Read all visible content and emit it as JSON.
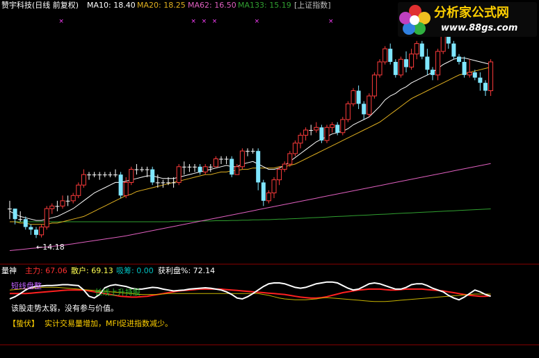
{
  "header": {
    "stock": "赞宇科技(日线 前复权)",
    "ma10": "MA10: 18.40",
    "ma20": "MA20: 18.25",
    "ma62": "MA62: 16.50",
    "ma133": "MA133: 15.19",
    "index": "[上证指数]"
  },
  "logo": {
    "title": "分析家公式网",
    "url": "www.88gs.com"
  },
  "main_annotations": {
    "low_label": "←14.18"
  },
  "indicator": {
    "name": "量神",
    "zhuli": "主力: 67.06",
    "sanhu": "散户: 69.13",
    "xichou": "吸筹: 0.00",
    "huoli": "获利盘%: 72.14",
    "label_short": "短线盘整",
    "label_long": "长线上升持股",
    "advice1": "该股走势太弱，没有参与价值。",
    "advice2_tag": "【蛰伏】",
    "advice2": "实计交易量增加，MFI促进指数减少。"
  },
  "colors": {
    "bg": "#000000",
    "up": "#ff3b3b",
    "down": "#7fe6ff",
    "flat": "#ffffff",
    "ma10": "#ffffff",
    "ma20": "#e0b020",
    "ma62": "#e060c0",
    "ma133": "#30a030",
    "zhuli": "#ff3030",
    "sanhu": "#ffff50",
    "xichou": "#00c0c0",
    "ind_white": "#ffffff",
    "ind_red": "#ff2020",
    "ind_yellow": "#c8b400",
    "border": "#8b0000",
    "marker": "#ff40ff"
  },
  "chart_data": [
    {
      "type": "candlestick",
      "title": "赞宇科技(日线 前复权)",
      "ylim": [
        13.5,
        22.2
      ],
      "candles": [
        [
          15.3,
          15.3,
          15.6,
          14.9
        ],
        [
          15.3,
          14.9,
          15.3,
          14.7
        ],
        [
          14.9,
          14.9,
          15.2,
          14.8
        ],
        [
          14.9,
          14.6,
          15.0,
          14.5
        ],
        [
          14.6,
          14.5,
          14.7,
          14.3
        ],
        [
          14.5,
          14.3,
          14.6,
          14.18
        ],
        [
          14.3,
          14.6,
          14.7,
          14.2
        ],
        [
          14.6,
          15.3,
          15.4,
          14.5
        ],
        [
          15.3,
          15.4,
          15.5,
          15.1
        ],
        [
          15.4,
          15.4,
          15.6,
          15.2
        ],
        [
          15.4,
          15.6,
          15.8,
          15.3
        ],
        [
          15.6,
          15.6,
          15.8,
          15.4
        ],
        [
          15.6,
          15.8,
          15.9,
          15.5
        ],
        [
          15.8,
          16.2,
          16.3,
          15.7
        ],
        [
          16.2,
          16.6,
          16.8,
          16.1
        ],
        [
          16.6,
          16.6,
          16.7,
          16.4
        ],
        [
          16.6,
          16.6,
          16.7,
          16.5
        ],
        [
          16.6,
          16.6,
          16.7,
          16.4
        ],
        [
          16.6,
          16.6,
          16.7,
          16.5
        ],
        [
          16.6,
          16.6,
          16.7,
          16.5
        ],
        [
          16.6,
          16.6,
          16.8,
          16.5
        ],
        [
          16.6,
          15.8,
          16.7,
          15.7
        ],
        [
          15.8,
          16.3,
          16.5,
          15.7
        ],
        [
          16.3,
          16.8,
          16.9,
          16.2
        ],
        [
          16.8,
          16.8,
          17.0,
          16.6
        ],
        [
          16.8,
          16.8,
          16.9,
          16.7
        ],
        [
          16.8,
          16.8,
          16.9,
          16.5
        ],
        [
          16.8,
          16.3,
          16.9,
          16.2
        ],
        [
          16.3,
          16.3,
          16.6,
          16.1
        ],
        [
          16.3,
          16.3,
          16.4,
          16.1
        ],
        [
          16.3,
          16.3,
          16.5,
          16.2
        ],
        [
          16.3,
          16.3,
          16.5,
          16.1
        ],
        [
          16.3,
          16.9,
          17.0,
          16.2
        ],
        [
          16.9,
          16.9,
          17.1,
          16.6
        ],
        [
          16.9,
          16.9,
          17.0,
          16.7
        ],
        [
          16.9,
          16.9,
          17.0,
          16.7
        ],
        [
          16.9,
          16.7,
          17.0,
          16.6
        ],
        [
          16.7,
          16.9,
          17.0,
          16.6
        ],
        [
          16.9,
          16.9,
          17.0,
          16.7
        ],
        [
          16.9,
          17.2,
          17.3,
          16.9
        ],
        [
          17.2,
          17.2,
          17.3,
          17.0
        ],
        [
          17.2,
          17.2,
          17.3,
          17.0
        ],
        [
          17.2,
          16.6,
          17.3,
          16.5
        ],
        [
          16.6,
          16.9,
          17.0,
          16.6
        ],
        [
          16.9,
          17.5,
          17.6,
          16.8
        ],
        [
          17.5,
          17.5,
          17.6,
          17.3
        ],
        [
          17.5,
          17.5,
          17.6,
          17.4
        ],
        [
          17.5,
          16.3,
          17.6,
          16.0
        ],
        [
          16.3,
          15.6,
          16.4,
          15.4
        ],
        [
          15.6,
          15.9,
          16.0,
          15.5
        ],
        [
          15.9,
          16.4,
          16.5,
          15.7
        ],
        [
          16.4,
          16.8,
          16.9,
          16.2
        ],
        [
          16.8,
          17.0,
          17.1,
          16.7
        ],
        [
          17.0,
          17.4,
          17.5,
          16.9
        ],
        [
          17.4,
          17.8,
          17.9,
          17.3
        ],
        [
          17.8,
          18.1,
          18.2,
          17.6
        ],
        [
          18.1,
          18.3,
          18.4,
          17.9
        ],
        [
          18.3,
          18.3,
          18.5,
          18.1
        ],
        [
          18.3,
          18.4,
          18.6,
          18.2
        ],
        [
          18.4,
          17.9,
          18.5,
          17.8
        ],
        [
          17.9,
          18.4,
          18.5,
          17.8
        ],
        [
          18.4,
          18.5,
          18.6,
          18.2
        ],
        [
          18.5,
          18.2,
          18.6,
          18.1
        ],
        [
          18.2,
          18.7,
          18.8,
          18.1
        ],
        [
          18.7,
          19.3,
          19.4,
          18.6
        ],
        [
          19.3,
          19.8,
          19.9,
          19.2
        ],
        [
          19.8,
          19.3,
          20.0,
          19.1
        ],
        [
          19.3,
          18.9,
          19.4,
          18.7
        ],
        [
          18.9,
          19.6,
          19.7,
          18.8
        ],
        [
          19.6,
          20.4,
          20.5,
          19.5
        ],
        [
          20.4,
          20.9,
          21.0,
          20.3
        ],
        [
          20.9,
          21.4,
          21.5,
          20.8
        ],
        [
          21.4,
          20.9,
          21.6,
          20.8
        ],
        [
          20.9,
          20.4,
          21.0,
          20.3
        ],
        [
          20.4,
          21.0,
          21.1,
          20.3
        ],
        [
          21.0,
          20.7,
          21.3,
          20.5
        ],
        [
          20.7,
          21.2,
          21.4,
          20.6
        ],
        [
          21.2,
          21.6,
          21.7,
          21.0
        ],
        [
          21.6,
          21.1,
          21.7,
          21.0
        ],
        [
          21.1,
          20.6,
          21.4,
          20.4
        ],
        [
          20.6,
          20.4,
          20.7,
          20.2
        ],
        [
          20.4,
          21.3,
          21.4,
          20.2
        ],
        [
          21.3,
          21.9,
          22.0,
          21.2
        ],
        [
          21.9,
          21.6,
          22.1,
          21.4
        ],
        [
          21.6,
          21.1,
          21.7,
          21.0
        ],
        [
          21.1,
          20.9,
          21.2,
          20.8
        ],
        [
          20.9,
          20.4,
          21.1,
          20.3
        ],
        [
          20.4,
          20.5,
          21.0,
          20.3
        ],
        [
          20.5,
          20.3,
          20.6,
          20.2
        ],
        [
          20.3,
          20.1,
          20.5,
          19.8
        ],
        [
          20.1,
          19.8,
          20.2,
          19.6
        ],
        [
          19.8,
          20.9,
          21.0,
          19.6
        ]
      ],
      "ma10": [
        15.2,
        15.1,
        15.0,
        14.95,
        14.9,
        14.85,
        14.85,
        14.9,
        14.95,
        15.0,
        15.1,
        15.2,
        15.3,
        15.45,
        15.6,
        15.75,
        15.9,
        16.0,
        16.1,
        16.2,
        16.3,
        16.3,
        16.35,
        16.4,
        16.45,
        16.5,
        16.55,
        16.55,
        16.5,
        16.45,
        16.45,
        16.45,
        16.5,
        16.55,
        16.6,
        16.65,
        16.7,
        16.75,
        16.8,
        16.85,
        16.9,
        16.95,
        16.9,
        16.9,
        17.0,
        17.05,
        17.1,
        17.0,
        16.9,
        16.8,
        16.8,
        16.85,
        16.95,
        17.1,
        17.25,
        17.4,
        17.55,
        17.7,
        17.85,
        17.95,
        18.05,
        18.15,
        18.2,
        18.25,
        18.35,
        18.5,
        18.6,
        18.7,
        18.8,
        19.0,
        19.2,
        19.45,
        19.6,
        19.7,
        19.85,
        19.95,
        20.1,
        20.2,
        20.3,
        20.4,
        20.5,
        20.65,
        20.8,
        20.9,
        21.0,
        21.05,
        21.05,
        21.0,
        20.95,
        20.9,
        20.85,
        20.8
      ],
      "ma20": [
        14.8,
        14.8,
        14.75,
        14.75,
        14.7,
        14.7,
        14.7,
        14.7,
        14.75,
        14.75,
        14.8,
        14.85,
        14.9,
        14.95,
        15.0,
        15.1,
        15.2,
        15.3,
        15.4,
        15.5,
        15.6,
        15.7,
        15.8,
        15.85,
        15.95,
        16.0,
        16.05,
        16.1,
        16.15,
        16.2,
        16.25,
        16.3,
        16.35,
        16.4,
        16.45,
        16.5,
        16.55,
        16.6,
        16.6,
        16.65,
        16.7,
        16.7,
        16.75,
        16.75,
        16.8,
        16.8,
        16.85,
        16.85,
        16.85,
        16.85,
        16.85,
        16.9,
        16.9,
        16.95,
        17.0,
        17.1,
        17.2,
        17.3,
        17.4,
        17.5,
        17.6,
        17.7,
        17.8,
        17.9,
        18.0,
        18.1,
        18.2,
        18.3,
        18.4,
        18.5,
        18.6,
        18.75,
        18.9,
        19.05,
        19.2,
        19.35,
        19.5,
        19.6,
        19.7,
        19.8,
        19.9,
        20.0,
        20.1,
        20.2,
        20.3,
        20.4,
        20.45,
        20.5,
        20.55,
        20.6,
        20.65,
        20.7
      ],
      "ma62": [
        13.7,
        13.72,
        13.74,
        13.76,
        13.78,
        13.8,
        13.82,
        13.84,
        13.86,
        13.88,
        13.9,
        13.93,
        13.96,
        13.99,
        14.02,
        14.05,
        14.08,
        14.11,
        14.14,
        14.17,
        14.2,
        14.23,
        14.26,
        14.3,
        14.34,
        14.38,
        14.42,
        14.46,
        14.5,
        14.54,
        14.58,
        14.62,
        14.66,
        14.7,
        14.74,
        14.78,
        14.82,
        14.86,
        14.9,
        14.94,
        14.98,
        15.02,
        15.06,
        15.1,
        15.14,
        15.18,
        15.22,
        15.26,
        15.3,
        15.34,
        15.38,
        15.42,
        15.46,
        15.5,
        15.54,
        15.58,
        15.62,
        15.66,
        15.7,
        15.74,
        15.78,
        15.82,
        15.86,
        15.9,
        15.94,
        15.98,
        16.02,
        16.06,
        16.1,
        16.14,
        16.18,
        16.22,
        16.26,
        16.3,
        16.34,
        16.38,
        16.42,
        16.46,
        16.5,
        16.54,
        16.58,
        16.62,
        16.66,
        16.7,
        16.74,
        16.78,
        16.82,
        16.86,
        16.9,
        16.94,
        16.98,
        17.02
      ],
      "ma133": [
        14.8,
        14.8,
        14.8,
        14.8,
        14.8,
        14.8,
        14.8,
        14.8,
        14.8,
        14.8,
        14.8,
        14.8,
        14.8,
        14.8,
        14.8,
        14.8,
        14.8,
        14.8,
        14.8,
        14.8,
        14.8,
        14.8,
        14.8,
        14.8,
        14.8,
        14.8,
        14.8,
        14.8,
        14.8,
        14.8,
        14.8,
        14.82,
        14.82,
        14.82,
        14.82,
        14.82,
        14.83,
        14.83,
        14.83,
        14.84,
        14.84,
        14.84,
        14.85,
        14.85,
        14.86,
        14.86,
        14.87,
        14.87,
        14.88,
        14.88,
        14.89,
        14.9,
        14.9,
        14.91,
        14.92,
        14.93,
        14.94,
        14.95,
        14.96,
        14.97,
        14.98,
        14.99,
        15.0,
        15.01,
        15.02,
        15.03,
        15.04,
        15.05,
        15.06,
        15.07,
        15.08,
        15.09,
        15.1,
        15.11,
        15.12,
        15.13,
        15.14,
        15.15,
        15.16,
        15.17,
        15.18,
        15.19,
        15.2,
        15.21,
        15.22,
        15.23,
        15.24,
        15.25,
        15.26,
        15.27,
        15.28,
        15.29
      ]
    },
    {
      "type": "line",
      "title": "量神",
      "ylim": [
        0,
        100
      ],
      "series": [
        {
          "name": "主力",
          "values": [
            62,
            62,
            62,
            62,
            63,
            64,
            65,
            66,
            67,
            68,
            69,
            70,
            70,
            70,
            70,
            68,
            66,
            64,
            62,
            60,
            58,
            56,
            55,
            54,
            54,
            55,
            56,
            58,
            60,
            62,
            64,
            66,
            68,
            69,
            70,
            71,
            72,
            72,
            72,
            72,
            72,
            71,
            70,
            69,
            68,
            67,
            66,
            65,
            64,
            63,
            62,
            61,
            60,
            58,
            56,
            54,
            53,
            52,
            52,
            53,
            55,
            58,
            61,
            64,
            66,
            68,
            70,
            71,
            72,
            72,
            72,
            71,
            70,
            70,
            71,
            72,
            72,
            72,
            72,
            71,
            70,
            69,
            68,
            66,
            64,
            62,
            60,
            58,
            57,
            56,
            56,
            57
          ]
        },
        {
          "name": "散户",
          "values": [
            70,
            71,
            72,
            73,
            74,
            75,
            76,
            76,
            76,
            76,
            75,
            74,
            73,
            72,
            71,
            70,
            69,
            68,
            67,
            66,
            65,
            64,
            63,
            62,
            61,
            60,
            60,
            60,
            60,
            61,
            62,
            62,
            62,
            62,
            62,
            62,
            62,
            62,
            62,
            62,
            62,
            62,
            62,
            62,
            62,
            62,
            62,
            62,
            60,
            58,
            55,
            52,
            50,
            49,
            48,
            48,
            48,
            49,
            50,
            52,
            53,
            52,
            51,
            50,
            49,
            48,
            47,
            46,
            45,
            44,
            44,
            44,
            45,
            46,
            47,
            48,
            49,
            50,
            51,
            52,
            53,
            54,
            55,
            56,
            57,
            58,
            59,
            60,
            61,
            61,
            61,
            61
          ]
        },
        {
          "name": "获利盘%",
          "values": [
            50,
            55,
            62,
            70,
            76,
            78,
            79,
            80,
            80,
            81,
            82,
            82,
            81,
            80,
            70,
            56,
            52,
            60,
            75,
            80,
            82,
            80,
            78,
            74,
            72,
            72,
            74,
            76,
            75,
            72,
            70,
            68,
            69,
            70,
            72,
            73,
            74,
            75,
            74,
            72,
            70,
            66,
            60,
            52,
            50,
            55,
            62,
            70,
            78,
            84,
            86,
            86,
            84,
            80,
            76,
            74,
            76,
            80,
            84,
            86,
            88,
            88,
            86,
            80,
            74,
            70,
            72,
            78,
            84,
            86,
            84,
            80,
            76,
            72,
            72,
            76,
            82,
            84,
            84,
            80,
            74,
            70,
            66,
            58,
            52,
            48,
            54,
            62,
            70,
            66,
            60,
            56
          ]
        }
      ]
    }
  ]
}
